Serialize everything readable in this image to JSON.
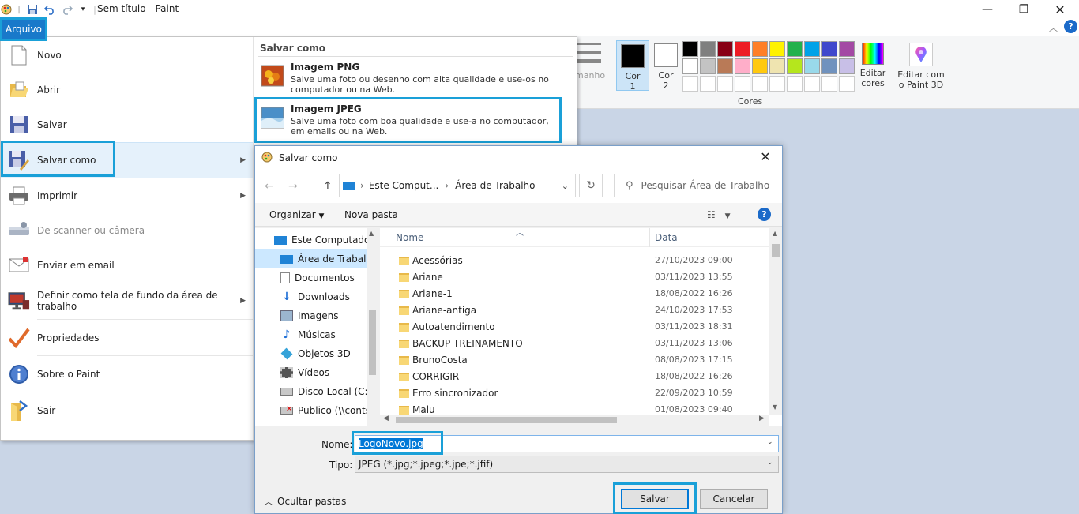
{
  "window": {
    "title": "Sem título - Paint"
  },
  "ribbon": {
    "arquivo_tab": "Arquivo",
    "tamanho_label": "manho",
    "cor1_label": "Cor\n1",
    "cor1_line1": "Cor",
    "cor1_line2": "1",
    "cor2_line1": "Cor",
    "cor2_line2": "2",
    "cores_label": "Cores",
    "editar_cores_line1": "Editar",
    "editar_cores_line2": "cores",
    "editar_3d_line1": "Editar com",
    "editar_3d_line2": "o Paint 3D",
    "palette_row1": [
      "#000000",
      "#7f7f7f",
      "#880015",
      "#ed1c24",
      "#ff7f27",
      "#fff200",
      "#22b14c",
      "#00a2e8",
      "#3f48cc",
      "#a349a4"
    ],
    "palette_row2": [
      "#ffffff",
      "#c3c3c3",
      "#b97a57",
      "#ffaec9",
      "#ffc90e",
      "#efe4b0",
      "#b5e61d",
      "#99d9ea",
      "#7092be",
      "#c8bfe7"
    ]
  },
  "file_menu": {
    "items": [
      {
        "label": "Novo"
      },
      {
        "label": "Abrir"
      },
      {
        "label": "Salvar"
      },
      {
        "label": "Salvar como"
      },
      {
        "label": "Imprimir"
      },
      {
        "label": "De scanner ou câmera"
      },
      {
        "label": "Enviar em email"
      },
      {
        "label": "Definir como tela de fundo da área de trabalho"
      },
      {
        "label": "Propriedades"
      },
      {
        "label": "Sobre o Paint"
      },
      {
        "label": "Sair"
      }
    ],
    "save_as_header": "Salvar como",
    "png_title": "Imagem PNG",
    "png_desc": "Salve uma foto ou desenho com alta qualidade e use-os no computador ou na Web.",
    "jpeg_title": "Imagem JPEG",
    "jpeg_desc": "Salve uma foto com boa qualidade e use-a no computador, em emails ou na Web."
  },
  "dialog": {
    "title": "Salvar como",
    "breadcrumb_1": "Este Comput...",
    "breadcrumb_2": "Área de Trabalho",
    "search_placeholder": "Pesquisar Área de Trabalho",
    "organizar": "Organizar",
    "nova_pasta": "Nova pasta",
    "nav_items": [
      "Este Computador",
      "Área de Trabalho",
      "Documentos",
      "Downloads",
      "Imagens",
      "Músicas",
      "Objetos 3D",
      "Vídeos",
      "Disco Local (C:)",
      "Publico (\\\\conts"
    ],
    "col_name": "Nome",
    "col_date": "Data",
    "files": [
      {
        "name": "Acessórias",
        "date": "27/10/2023 09:00"
      },
      {
        "name": "Ariane",
        "date": "03/11/2023 13:55"
      },
      {
        "name": "Ariane-1",
        "date": "18/08/2022 16:26"
      },
      {
        "name": "Ariane-antiga",
        "date": "24/10/2023 17:53"
      },
      {
        "name": "Autoatendimento",
        "date": "03/11/2023 18:31"
      },
      {
        "name": "BACKUP TREINAMENTO",
        "date": "03/11/2023 13:06"
      },
      {
        "name": "BrunoCosta",
        "date": "08/08/2023 17:15"
      },
      {
        "name": "CORRIGIR",
        "date": "18/08/2022 16:26"
      },
      {
        "name": "Erro sincronizador",
        "date": "22/09/2023 10:59"
      },
      {
        "name": "Malu",
        "date": "01/08/2023 09:40"
      }
    ],
    "nome_label": "Nome:",
    "nome_value": "LogoNovo.jpg",
    "tipo_label": "Tipo:",
    "tipo_value": "JPEG (*.jpg;*.jpeg;*.jpe;*.jfif)",
    "ocultar_pastas": "Ocultar pastas",
    "salvar_button": "Salvar",
    "cancelar_button": "Cancelar"
  }
}
